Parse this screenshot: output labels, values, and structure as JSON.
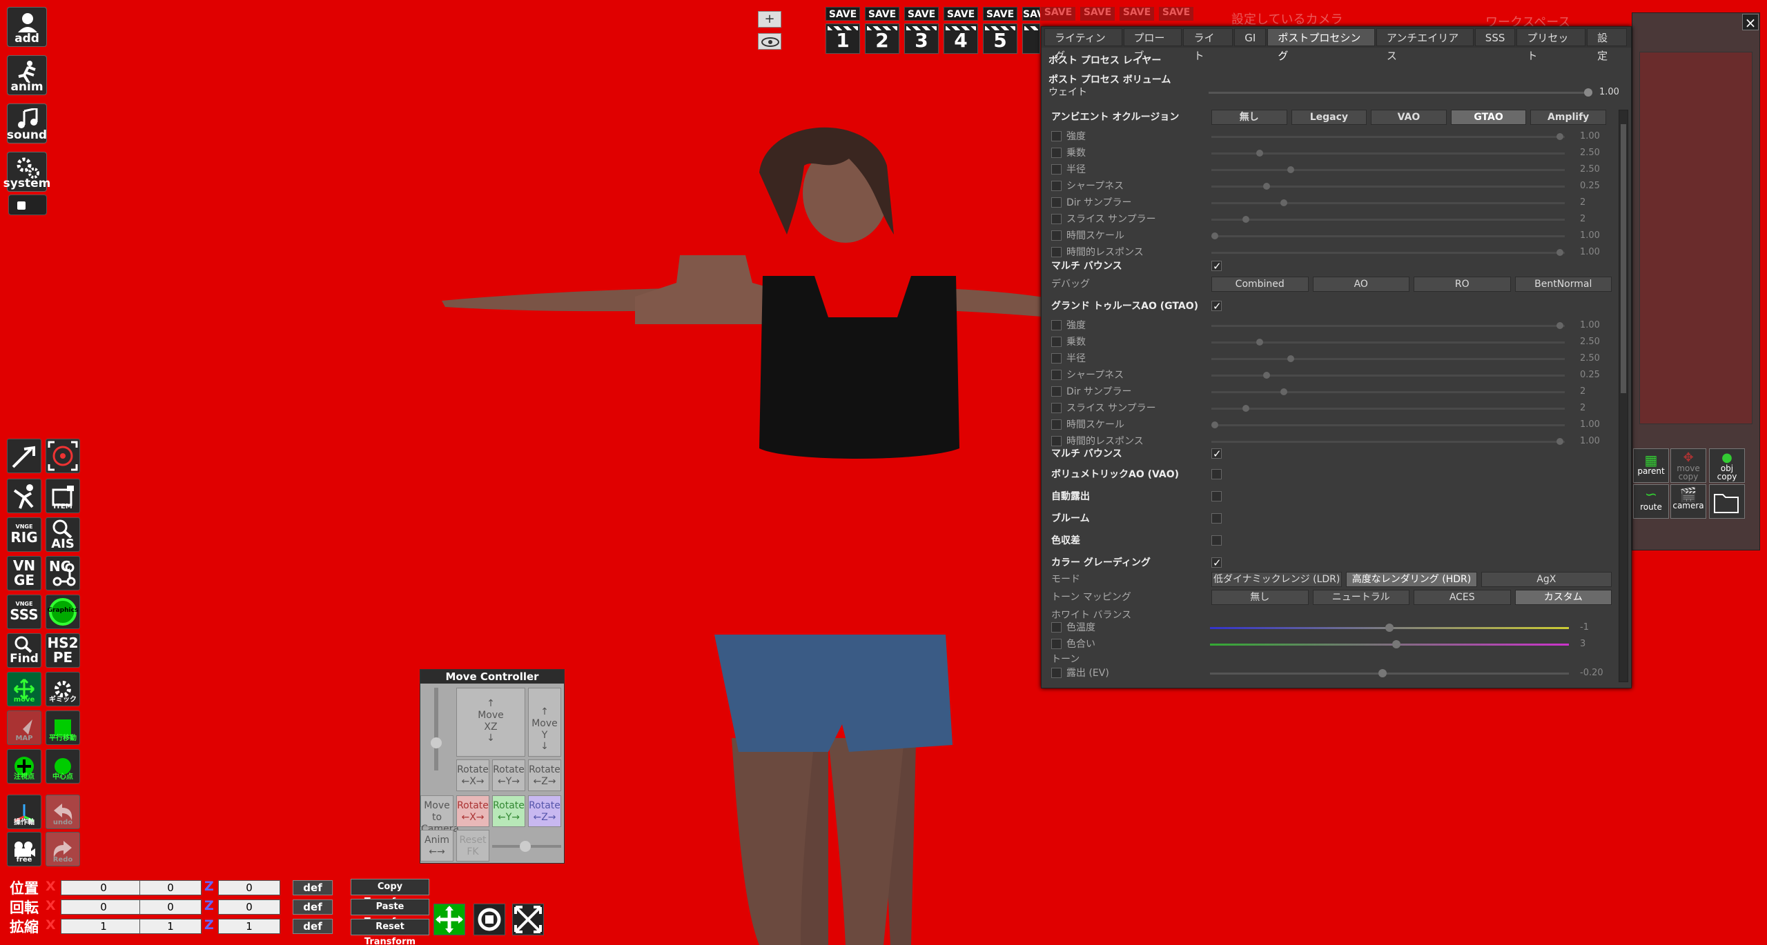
{
  "left_toolbar": {
    "main": [
      {
        "label": "add",
        "icon": "user-add-icon"
      },
      {
        "label": "anim",
        "icon": "running-figure-icon"
      },
      {
        "label": "sound",
        "icon": "music-note-icon"
      },
      {
        "label": "system",
        "icon": "gear-icon"
      }
    ],
    "tools": [
      [
        "",
        "",
        "VNGE RIG",
        "VNGE SSS",
        "Find",
        "move",
        "MAP",
        "注視点",
        "操作軸",
        "free"
      ],
      [
        "",
        "ITEM",
        "AIS",
        "NCO",
        "Graphics",
        "HS2 PE",
        "ギミック",
        "平行移動",
        "中心点",
        "undo",
        "Redo"
      ]
    ],
    "labels": {
      "rig_top": "VNGE",
      "rig": "RIG",
      "vnge": "VN",
      "vnge2": "GE",
      "sss_top": "VNGE",
      "sss": "SSS",
      "find": "Find",
      "move": "move",
      "map": "MAP",
      "gaze": "注視点",
      "axis": "操作軸",
      "free": "free",
      "item": "ITEM",
      "ais": "AIS",
      "nco": "NC",
      "graphics": "Graphics",
      "hs2pe": "HS2",
      "hs2pe2": "PE",
      "gimmick": "ギミック",
      "parallel": "平行移動",
      "center": "中心点",
      "undo": "undo",
      "redo": "Redo"
    }
  },
  "top": {
    "zoom_plus": "+",
    "save_label": "SAVE",
    "slots": [
      "1",
      "2",
      "3",
      "4",
      "5"
    ],
    "faded_saves": [
      "SAVE",
      "SAVE",
      "SAVE",
      "SAVE",
      "SAVE"
    ],
    "ghost_title": "設定しているカメラ",
    "ghost_workspace": "ワークスペース"
  },
  "panel": {
    "tabs": [
      "ライティング",
      "プローブ",
      "ライト",
      "GI",
      "ポストプロセシング",
      "アンチエイリアス",
      "SSS",
      "プリセット",
      "設定"
    ],
    "active_tab": "ポストプロセシング",
    "layer_title": "ポスト プロセス レイヤー",
    "volume_title": "ポスト プロセス ボリューム",
    "weight_label": "ウェイト",
    "weight_value": "1.00",
    "ao_label": "アンビエント オクルージョン",
    "ao_modes": [
      "無し",
      "Legacy",
      "VAO",
      "GTAO",
      "Amplify"
    ],
    "ao_active": "GTAO",
    "params1": [
      {
        "label": "強度",
        "value": "1.00",
        "pos": 1.0
      },
      {
        "label": "乗数",
        "value": "2.50",
        "pos": 0.13
      },
      {
        "label": "半径",
        "value": "2.50",
        "pos": 0.22
      },
      {
        "label": "シャープネス",
        "value": "0.25",
        "pos": 0.15
      },
      {
        "label": "Dir サンプラー",
        "value": "2",
        "pos": 0.2
      },
      {
        "label": "スライス サンプラー",
        "value": "2",
        "pos": 0.09
      },
      {
        "label": "時間スケール",
        "value": "1.00",
        "pos": 0.0
      },
      {
        "label": "時間的レスポンス",
        "value": "1.00",
        "pos": 1.0
      }
    ],
    "multibounce": "マルチ バウンス",
    "debug_label": "デバッグ",
    "debug_modes": [
      "Combined",
      "AO",
      "RO",
      "BentNormal"
    ],
    "gtao_label": "グランド トゥルースAO (GTAO)",
    "params2": [
      {
        "label": "強度",
        "value": "1.00",
        "pos": 1.0
      },
      {
        "label": "乗数",
        "value": "2.50",
        "pos": 0.13
      },
      {
        "label": "半径",
        "value": "2.50",
        "pos": 0.22
      },
      {
        "label": "シャープネス",
        "value": "0.25",
        "pos": 0.15
      },
      {
        "label": "Dir サンプラー",
        "value": "2",
        "pos": 0.2
      },
      {
        "label": "スライス サンプラー",
        "value": "2",
        "pos": 0.09
      },
      {
        "label": "時間スケール",
        "value": "1.00",
        "pos": 0.0
      },
      {
        "label": "時間的レスポンス",
        "value": "1.00",
        "pos": 1.0
      }
    ],
    "multibounce2": "マルチ バウンス",
    "vao": "ボリュメトリックAO (VAO)",
    "auto_exposure": "自動露出",
    "bloom": "ブルーム",
    "chromatic": "色収差",
    "color_grading": "カラー グレーディング",
    "mode_label": "モード",
    "modes": [
      "低ダイナミックレンジ (LDR)",
      "高度なレンダリング (HDR)",
      "AgX"
    ],
    "mode_active": "高度なレンダリング (HDR)",
    "tonemap_label": "トーン マッピング",
    "tonemaps": [
      "無し",
      "ニュートラル",
      "ACES",
      "カスタム"
    ],
    "tonemap_active": "カスタム",
    "white_balance": "ホワイト バランス",
    "temperature": "色温度",
    "temperature_value": "-1",
    "tint": "色合い",
    "tint_value": "3",
    "tone": "トーン",
    "exposure": "露出 (EV)",
    "exposure_value": "-0.20"
  },
  "right_panel": {
    "icons": [
      {
        "label": "parent"
      },
      {
        "label": "move copy"
      },
      {
        "label": "obj copy"
      },
      {
        "label": "route"
      },
      {
        "label": "camera"
      },
      {
        "label": ""
      }
    ]
  },
  "move_controller": {
    "title": "Move Controller",
    "move_xz": "Move\nXZ",
    "move_y": "Move Y",
    "rot": [
      "Rotate\n←X→",
      "Rotate\n←Y→",
      "Rotate\n←Z→"
    ],
    "move_to_camera": "Move to Camera",
    "anim": "Anim",
    "reset_fk": "Reset FK"
  },
  "transform": {
    "rows": [
      {
        "label": "位置",
        "x": "0",
        "y": "0",
        "z": "0"
      },
      {
        "label": "回転",
        "x": "0",
        "y": "0",
        "z": "0"
      },
      {
        "label": "拡縮",
        "x": "1",
        "y": "1",
        "z": "1"
      }
    ],
    "def": "def",
    "copy": "Copy Transform",
    "paste": "Paste Transform",
    "reset": "Reset Transform"
  }
}
